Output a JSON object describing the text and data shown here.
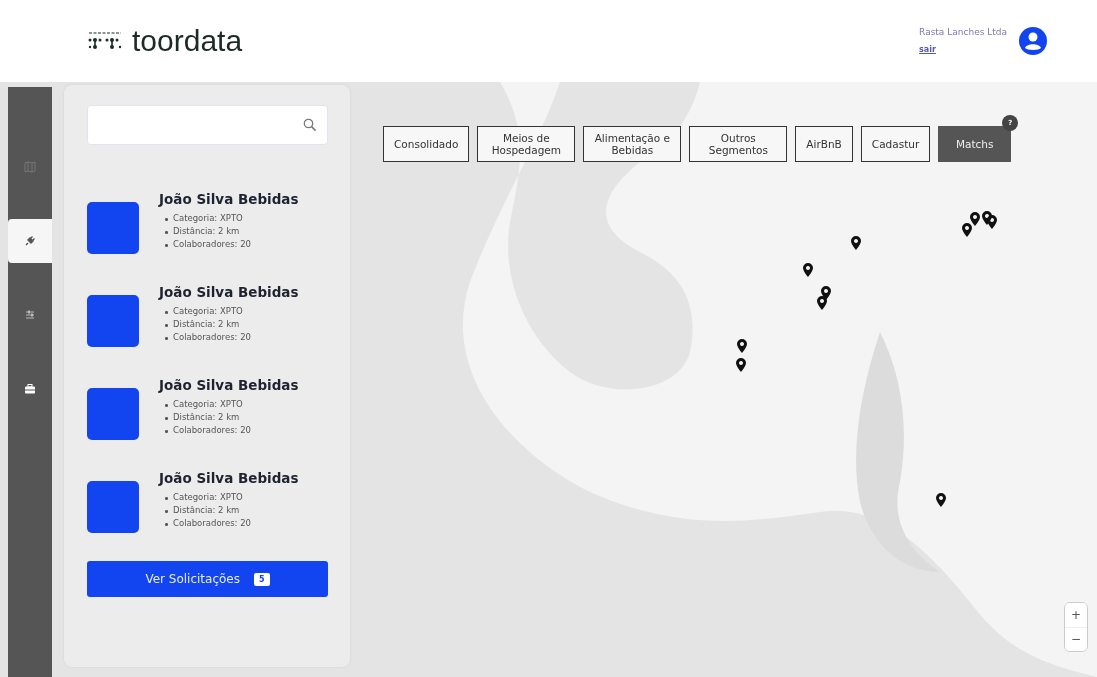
{
  "header": {
    "logo": "toordata",
    "user_name": "Rasta Lanches Ltda",
    "logout_link": "sair"
  },
  "sidebar": {
    "items": [
      {
        "kind": "map",
        "selected": false
      },
      {
        "kind": "plug",
        "selected": true
      },
      {
        "kind": "sliders",
        "selected": false
      },
      {
        "kind": "briefcase",
        "selected": false
      }
    ]
  },
  "results": [
    {
      "title": "João Silva Bebidas",
      "details": [
        "Categoria: XPTO",
        "Distância: 2 km",
        "Colaboradores: 20"
      ]
    },
    {
      "title": "João Silva Bebidas",
      "details": [
        "Categoria: XPTO",
        "Distância: 2 km",
        "Colaboradores: 20"
      ]
    },
    {
      "title": "João Silva Bebidas",
      "details": [
        "Categoria: XPTO",
        "Distância: 2 km",
        "Colaboradores: 20"
      ]
    },
    {
      "title": "João Silva Bebidas",
      "details": [
        "Categoria: XPTO",
        "Distância: 2 km",
        "Colaboradores: 20"
      ]
    }
  ],
  "requests_button": {
    "label": "Ver Solicitações",
    "count": "5"
  },
  "filters": [
    {
      "label": "Consolidado",
      "selected": false
    },
    {
      "label": "Meios de Hospedagem",
      "selected": false
    },
    {
      "label": "Alimentação e Bebidas",
      "selected": false
    },
    {
      "label": "Outros Segmentos",
      "selected": false
    },
    {
      "label": "AirBnB",
      "selected": false
    },
    {
      "label": "Cadastur",
      "selected": false
    },
    {
      "label": "Matchs",
      "selected": true,
      "badge": "?"
    }
  ],
  "zoom_controls": {
    "zoom_in": "+",
    "zoom_out": "−"
  }
}
